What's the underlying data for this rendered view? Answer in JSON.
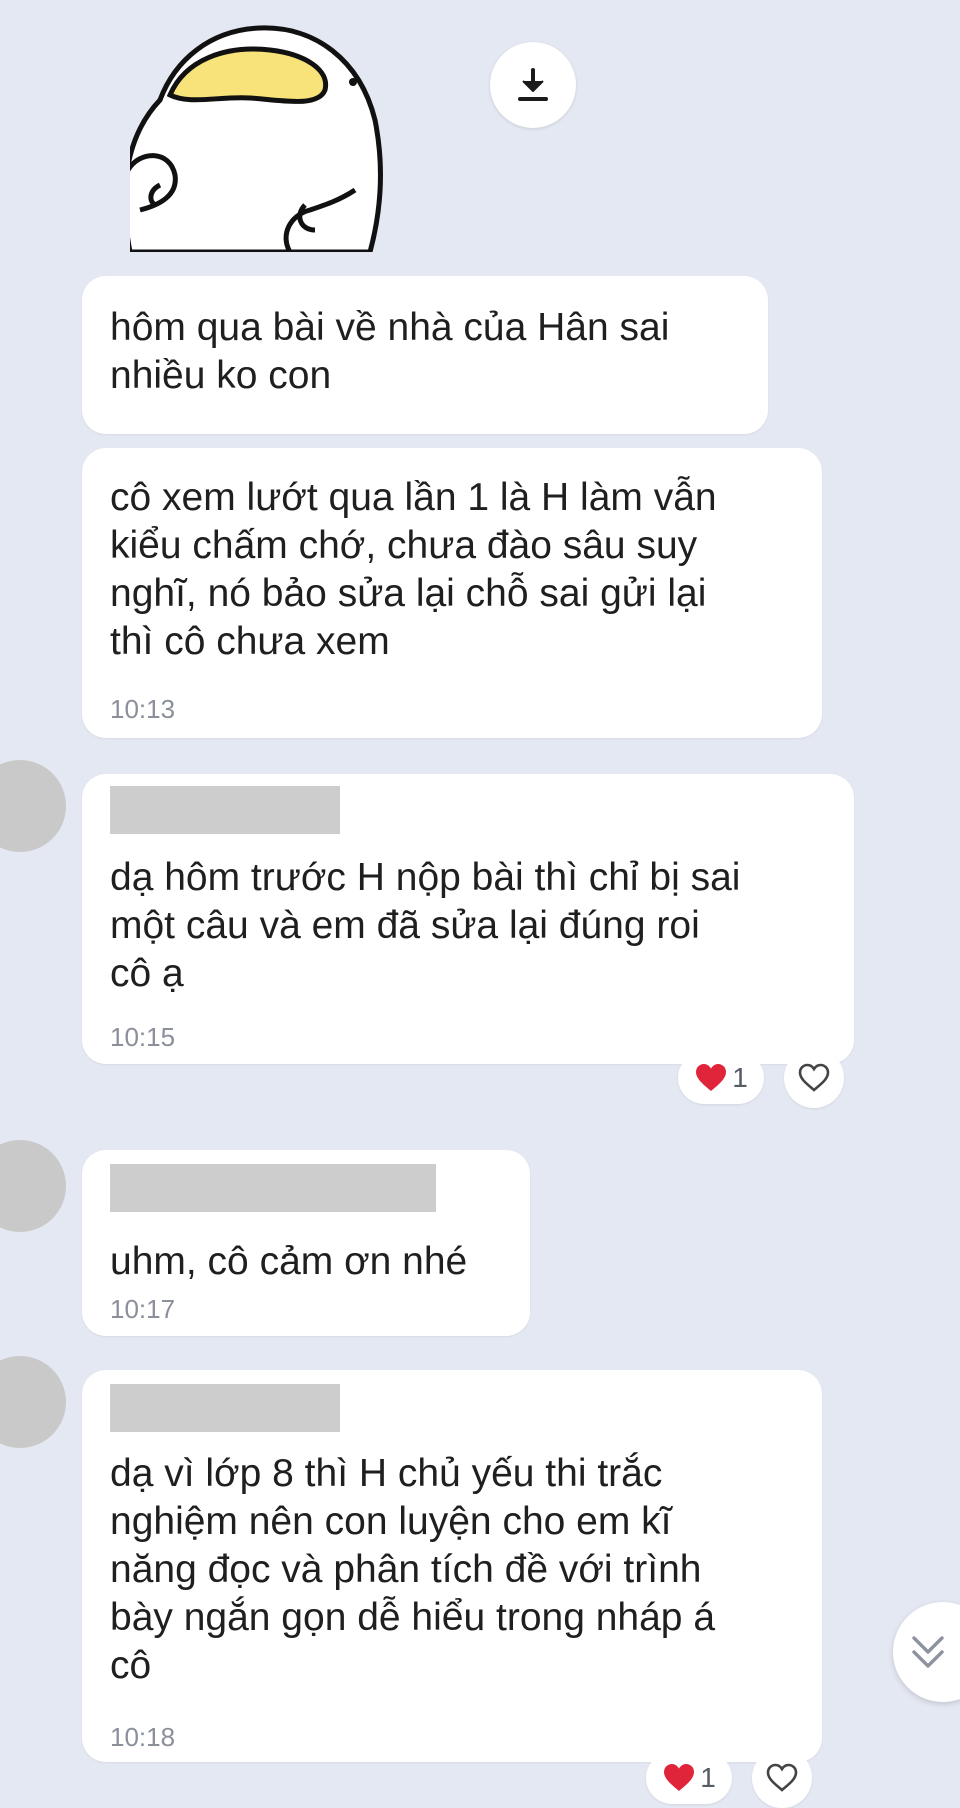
{
  "messages": [
    {
      "text": "hôm qua bài về nhà của Hân sai\nnhiều ko con",
      "time": ""
    },
    {
      "text": "cô xem lướt qua lần 1 là H làm vẫn\nkiểu chấm chớ, chưa đào sâu suy\nnghĩ, nó bảo sửa lại chỗ sai gửi lại\nthì cô chưa xem",
      "time": "10:13"
    },
    {
      "text": "dạ hôm trước H nộp bài thì chỉ bị sai\nmột câu và em đã sửa lại đúng roi\ncô ạ",
      "time": "10:15",
      "reaction_count": "1"
    },
    {
      "text": "uhm, cô cảm ơn nhé",
      "time": "10:17"
    },
    {
      "text": "dạ vì lớp 8 thì H chủ yếu thi trắc\nnghiệm nên con luyện cho em kĩ\nnăng đọc và phân tích đề với trình\nbày ngắn gọn dễ hiểu trong nháp á\ncô",
      "time": "10:18",
      "reaction_count": "1"
    }
  ],
  "icons": {
    "download": "download-icon",
    "heart_filled": "heart-filled-icon",
    "heart_outline": "heart-outline-icon",
    "scroll_down": "double-chevron-down-icon"
  },
  "colors": {
    "background": "#e4e8f2",
    "bubble": "#ffffff",
    "heart": "#e0243a",
    "timestamp": "#8a8f99"
  }
}
